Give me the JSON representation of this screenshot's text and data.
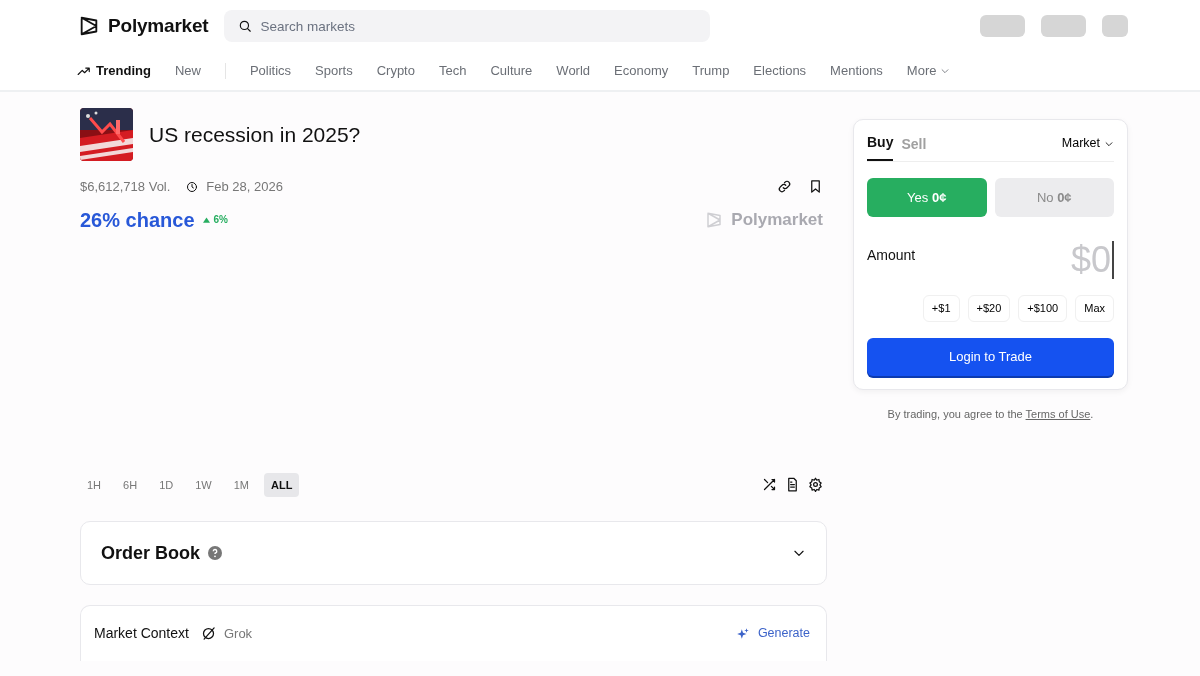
{
  "header": {
    "logo": "Polymarket",
    "search": {
      "placeholder": "Search markets"
    }
  },
  "nav": {
    "primary": [
      {
        "label": "Trending",
        "selected": true,
        "kind": "trending"
      },
      {
        "label": "New",
        "selected": false,
        "kind": "plain"
      }
    ],
    "categories": [
      {
        "label": "Politics",
        "kind": "plain"
      },
      {
        "label": "Sports",
        "kind": "plain"
      },
      {
        "label": "Crypto",
        "kind": "plain"
      },
      {
        "label": "Tech",
        "kind": "plain"
      },
      {
        "label": "Culture",
        "kind": "plain"
      },
      {
        "label": "World",
        "kind": "plain"
      },
      {
        "label": "Economy",
        "kind": "plain"
      },
      {
        "label": "Trump",
        "kind": "plain"
      },
      {
        "label": "Elections",
        "kind": "plain"
      },
      {
        "label": "Mentions",
        "kind": "plain"
      },
      {
        "label": "More",
        "kind": "dropdown"
      }
    ]
  },
  "market": {
    "title": "US recession in 2025?",
    "volume": "$6,612,718 Vol.",
    "end_date": "Feb 28, 2026",
    "chance": "26% chance",
    "change": "6%",
    "chart_watermark": "Polymarket",
    "timeframes": [
      {
        "label": "1H",
        "selected": false
      },
      {
        "label": "6H",
        "selected": false
      },
      {
        "label": "1D",
        "selected": false
      },
      {
        "label": "1W",
        "selected": false
      },
      {
        "label": "1M",
        "selected": false
      },
      {
        "label": "ALL",
        "selected": true
      }
    ]
  },
  "order_book": {
    "title": "Order Book",
    "expanded": false
  },
  "market_context": {
    "title": "Market Context",
    "source": "Grok",
    "action": "Generate"
  },
  "trade": {
    "tabs": [
      {
        "label": "Buy",
        "selected": true
      },
      {
        "label": "Sell",
        "selected": false
      }
    ],
    "order_type": "Market",
    "outcomes": [
      {
        "label": "Yes",
        "price": "0¢",
        "selected": true
      },
      {
        "label": "No",
        "price": "0¢",
        "selected": false
      }
    ],
    "amount_label": "Amount",
    "amount": {
      "placeholder": "$0"
    },
    "quick_amounts": [
      "+$1",
      "+$20",
      "+$100",
      "Max"
    ],
    "submit": "Login to Trade",
    "terms": {
      "text": "By trading, you agree to the ",
      "link": "Terms of Use",
      "end": "."
    }
  }
}
